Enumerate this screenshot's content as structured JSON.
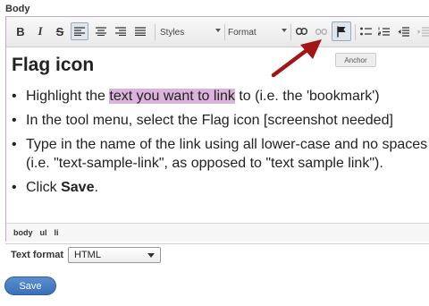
{
  "field": {
    "label": "Body"
  },
  "toolbar": {
    "bold": "B",
    "italic": "I",
    "strike": "S",
    "styles_label": "Styles",
    "format_label": "Format",
    "anchor_tooltip": "Anchor",
    "accent_active": "#dfe6ee"
  },
  "content": {
    "heading": "Flag icon",
    "items": [
      {
        "pre": "Highlight the ",
        "highlight": "text you want to link",
        "post": " to (i.e. the 'bookmark')"
      },
      {
        "text": "In the tool menu, select the Flag icon [screenshot needed]"
      },
      {
        "line1": "Type in the name of the link using all lower-case and no spaces",
        "line2": "(i.e. \"text-sample-link\", as opposed to \"text sample link\")."
      },
      {
        "pre": "Click ",
        "bold": "Save",
        "post": "."
      }
    ],
    "highlight_color": "#dcb3dc"
  },
  "statusbar": {
    "path": [
      "body",
      "ul",
      "li"
    ]
  },
  "text_format": {
    "label": "Text format",
    "selected": "HTML"
  },
  "save_button": {
    "label": "Save",
    "color": "#3a6fb8"
  },
  "annotation": {
    "arrow_color": "#a31515"
  }
}
